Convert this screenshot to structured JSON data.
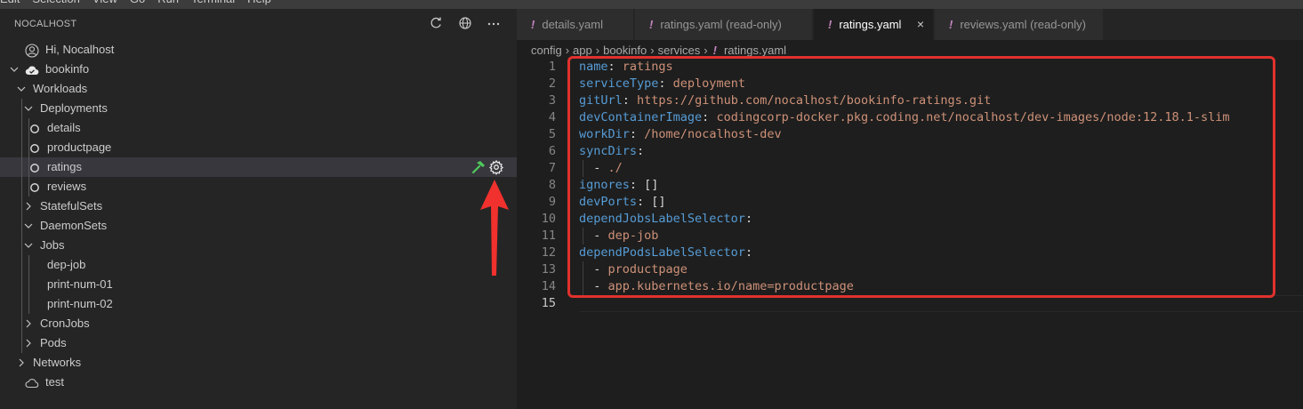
{
  "menubar": {
    "items": [
      "Edit",
      "Selection",
      "View",
      "Go",
      "Run",
      "Terminal",
      "Help"
    ]
  },
  "sidebar": {
    "title": "NOCALHOST",
    "header_icons": [
      "refresh-icon",
      "globe-icon",
      "more-icon"
    ],
    "tree": [
      {
        "label": "Hi, Nocalhost",
        "icon": "account-icon"
      },
      {
        "label": "bookinfo",
        "icon": "cloud-filled-icon",
        "expanded": true
      },
      {
        "label": "Workloads",
        "expanded": true
      },
      {
        "label": "Deployments",
        "expanded": true
      },
      {
        "label": "details",
        "icon": "circle-outline-icon"
      },
      {
        "label": "productpage",
        "icon": "circle-outline-icon"
      },
      {
        "label": "ratings",
        "icon": "circle-outline-icon",
        "selected": true,
        "actions": [
          "hammer-icon",
          "gear-icon"
        ]
      },
      {
        "label": "reviews",
        "icon": "circle-outline-icon"
      },
      {
        "label": "StatefulSets",
        "expanded": false
      },
      {
        "label": "DaemonSets",
        "expanded": true
      },
      {
        "label": "Jobs",
        "expanded": true
      },
      {
        "label": "dep-job"
      },
      {
        "label": "print-num-01"
      },
      {
        "label": "print-num-02"
      },
      {
        "label": "CronJobs",
        "expanded": false
      },
      {
        "label": "Pods",
        "expanded": false
      },
      {
        "label": "Networks",
        "expanded": false
      },
      {
        "label": "test",
        "icon": "cloud-outline-icon"
      }
    ]
  },
  "editor": {
    "tabs": [
      {
        "label": "details.yaml",
        "active": false
      },
      {
        "label": "ratings.yaml (read-only)",
        "active": false
      },
      {
        "label": "ratings.yaml",
        "active": true,
        "close": "×"
      },
      {
        "label": "reviews.yaml (read-only)",
        "active": false
      }
    ],
    "tab_marker": "!",
    "breadcrumb": [
      "config",
      "app",
      "bookinfo",
      "services"
    ],
    "breadcrumb_file": "ratings.yaml",
    "lines": [
      {
        "n": "1",
        "key": "name",
        "val": "ratings"
      },
      {
        "n": "2",
        "key": "serviceType",
        "val": "deployment"
      },
      {
        "n": "3",
        "key": "gitUrl",
        "val": "https://github.com/nocalhost/bookinfo-ratings.git"
      },
      {
        "n": "4",
        "key": "devContainerImage",
        "val": "codingcorp-docker.pkg.coding.net/nocalhost/dev-images/node:12.18.1-slim"
      },
      {
        "n": "5",
        "key": "workDir",
        "val": "/home/nocalhost-dev"
      },
      {
        "n": "6",
        "key": "syncDirs",
        "val": ""
      },
      {
        "n": "7",
        "item": "./"
      },
      {
        "n": "8",
        "key": "ignores",
        "plain": "[]"
      },
      {
        "n": "9",
        "key": "devPorts",
        "plain": "[]"
      },
      {
        "n": "10",
        "key": "dependJobsLabelSelector",
        "val": ""
      },
      {
        "n": "11",
        "item": "dep-job"
      },
      {
        "n": "12",
        "key": "dependPodsLabelSelector",
        "val": ""
      },
      {
        "n": "13",
        "item": "productpage"
      },
      {
        "n": "14",
        "item": "app.kubernetes.io/name=productpage"
      },
      {
        "n": "15",
        "empty": true
      }
    ]
  },
  "colors": {
    "highlight": "#e0312d",
    "arrow": "#f0312d",
    "yaml_key": "#569cd6",
    "yaml_value": "#ce9178"
  }
}
